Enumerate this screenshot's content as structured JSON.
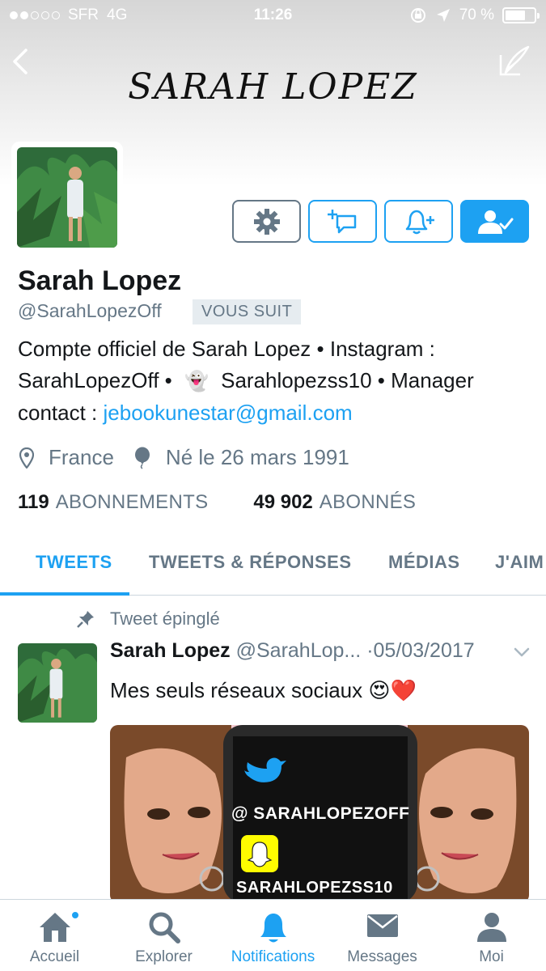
{
  "status_bar": {
    "carrier": "SFR",
    "network": "4G",
    "time": "11:26",
    "battery": "70 %",
    "battery_level": 0.7
  },
  "header": {
    "banner_title": "SARAH LOPEZ"
  },
  "profile": {
    "name": "Sarah Lopez",
    "handle": "@SarahLopezOff",
    "follows_you": "VOUS SUIT",
    "bio_line1": "Compte officiel de Sarah Lopez • Instagram :",
    "bio_line2a": "SarahLopezOff •",
    "bio_ghost": "👻",
    "bio_line2b": "Sarahlopezss10 • Manager",
    "bio_line3a": "contact : ",
    "bio_email": "jebookunestar@gmail.com",
    "location": "France",
    "birth": "Né le 26 mars 1991",
    "following_count": "119",
    "following_label": "ABONNEMENTS",
    "followers_count": "49 902",
    "followers_label": "ABONNÉS"
  },
  "tabs": [
    {
      "label": "TWEETS"
    },
    {
      "label": "TWEETS & RÉPONSES"
    },
    {
      "label": "MÉDIAS"
    },
    {
      "label": "J'AIM"
    }
  ],
  "tweet": {
    "pinned_label": "Tweet épinglé",
    "author": "Sarah Lopez",
    "handle": "@SarahLop...",
    "sep": "·",
    "date": "05/03/2017",
    "text": "Mes seuls réseaux sociaux 😍❤️",
    "media": {
      "twitter_handle": "@ SARAHLOPEZOFF",
      "snapchat_handle": "SARAHLOPEZSS10"
    }
  },
  "bottom_nav": [
    {
      "label": "Accueil",
      "icon": "home-icon"
    },
    {
      "label": "Explorer",
      "icon": "search-icon"
    },
    {
      "label": "Notifications",
      "icon": "bell-icon"
    },
    {
      "label": "Messages",
      "icon": "envelope-icon"
    },
    {
      "label": "Moi",
      "icon": "person-icon"
    }
  ],
  "colors": {
    "accent": "#1da1f2",
    "text": "#14171a",
    "secondary_text": "#657786"
  }
}
